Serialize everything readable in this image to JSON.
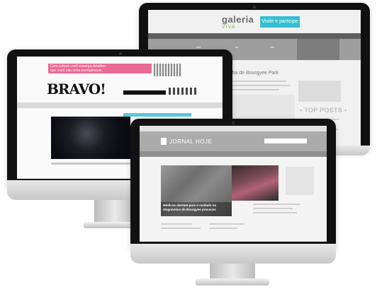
{
  "back_monitor": {
    "logo": "galeria",
    "logo_sub": "VIVA",
    "cta_button": "Visite e participe",
    "article_title": "Ilha de Bourgyee Park",
    "top_posts": "• TOP POSTS •"
  },
  "left_monitor": {
    "promo_line1": "Com cultura você enxerga detalhes",
    "promo_line2": "que você não veria normalmente.",
    "brand": "BRAVO!"
  },
  "front_monitor": {
    "logo": "JORNAL HOJE",
    "headline": "Médicos alertam para o cuidado no diagnóstico de Bourgyee precoces"
  }
}
